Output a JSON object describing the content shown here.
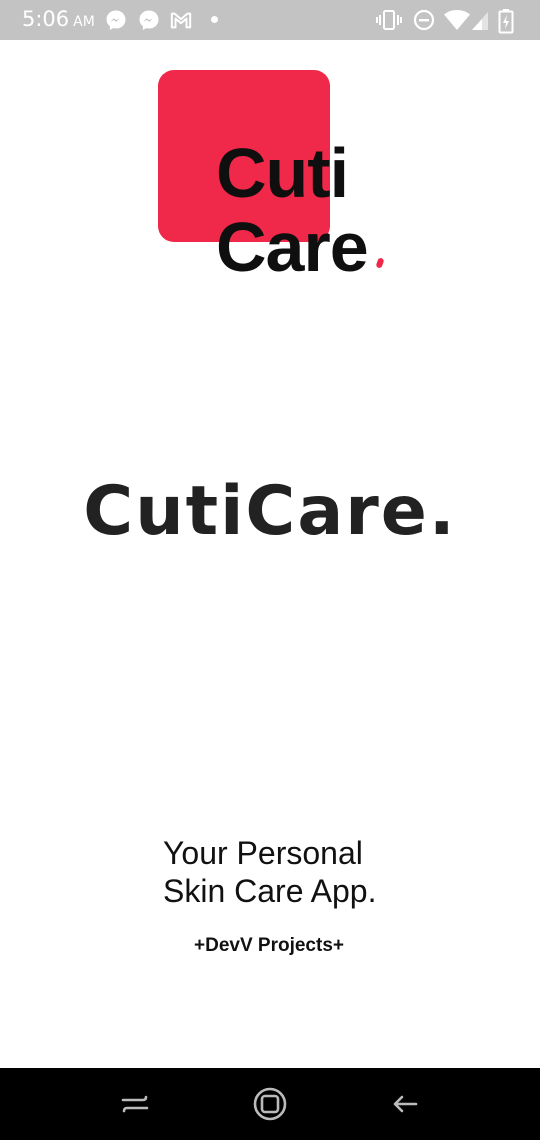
{
  "status_bar": {
    "time": "5:06",
    "ampm": "AM",
    "notification_icons": [
      "messenger-icon",
      "messenger-icon",
      "gmail-icon",
      "more-notifications-dot"
    ],
    "system_icons": [
      "vibrate-icon",
      "do-not-disturb-icon",
      "wifi-icon",
      "signal-icon",
      "battery-charging-icon"
    ]
  },
  "logo": {
    "line1": "Cuti",
    "line2": "Care",
    "accent_color": "#f0284a"
  },
  "title": "CutiCare.",
  "tagline": {
    "line1": "Your Personal",
    "line2": "Skin Care App."
  },
  "credit": "+DevV Projects+",
  "nav_bar": {
    "buttons": [
      "recents-icon",
      "home-icon",
      "back-icon"
    ]
  }
}
